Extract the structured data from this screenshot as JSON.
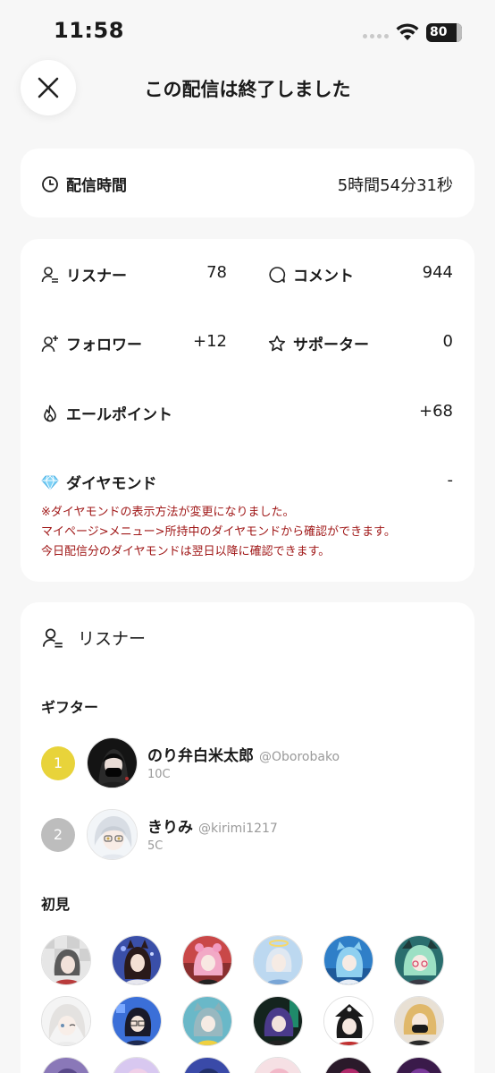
{
  "status_bar": {
    "time": "11:58",
    "battery": "80"
  },
  "header": {
    "title": "この配信は終了しました",
    "close_icon": "close-icon"
  },
  "duration": {
    "label": "配信時間",
    "value": "5時間54分31秒",
    "icon": "clock-icon"
  },
  "stats": {
    "listeners": {
      "label": "リスナー",
      "value": "78",
      "icon": "user-list-icon"
    },
    "comments": {
      "label": "コメント",
      "value": "944",
      "icon": "chat-bubble-icon"
    },
    "followers": {
      "label": "フォロワー",
      "value": "+12",
      "icon": "user-plus-icon"
    },
    "supporters": {
      "label": "サポーター",
      "value": "0",
      "icon": "star-icon"
    },
    "yell_points": {
      "label": "エールポイント",
      "value": "+68",
      "icon": "flame-icon"
    },
    "diamonds": {
      "label": "ダイヤモンド",
      "value": "-",
      "icon": "diamond-icon"
    },
    "notice": [
      "※ダイヤモンドの表示方法が変更になりました。",
      "マイページ>メニュー>所持中のダイヤモンドから確認ができます。",
      "今日配信分のダイヤモンドは翌日以降に確認できます。"
    ]
  },
  "listeners_section": {
    "title": "リスナー",
    "gifters_title": "ギフター",
    "gifters": [
      {
        "rank": "1",
        "name": "のり弁白米太郎",
        "handle": "@Oborobako",
        "coins": "10C",
        "rank_color": "#e8d33a"
      },
      {
        "rank": "2",
        "name": "きりみ",
        "handle": "@kirimi1217",
        "coins": "5C",
        "rank_color": "#bdbdbd"
      }
    ],
    "first_time_title": "初見"
  },
  "colors": {
    "accent_notice": "#a01818",
    "background": "#f7f7f7"
  }
}
